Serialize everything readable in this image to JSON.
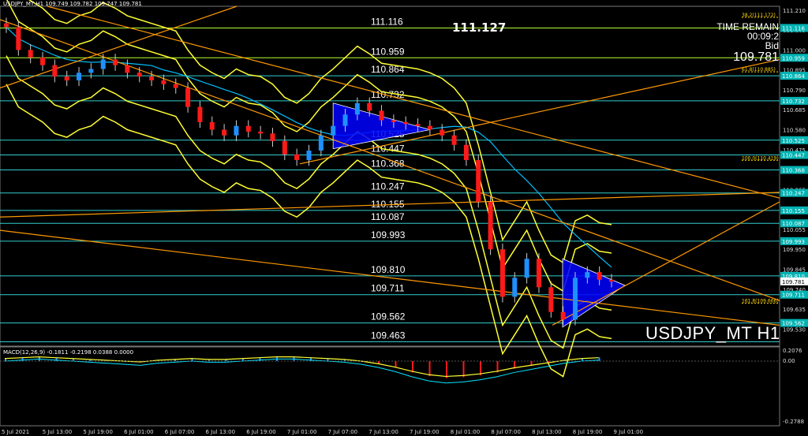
{
  "header": {
    "symbol_line": "USDJPY_MT,H1  109.749 109.782 109.747 109.781",
    "watermark": "USDJPY_MT H1",
    "macd_line": "MACD(12,26,9) -0.1811 -0.2198 0.0388 0.0000"
  },
  "timer": {
    "label": "TIME REMAIN",
    "remain": "00:09:2",
    "bid_label": "Bid",
    "bid": "109.781"
  },
  "current_price_label": "111.127",
  "levels": [
    {
      "value": "111.116",
      "price": 111.116,
      "axis": "111.116"
    },
    {
      "value": "110.959",
      "price": 110.959,
      "axis": "110.959"
    },
    {
      "value": "110.864",
      "price": 110.864,
      "axis": "110.864"
    },
    {
      "value": "110.732",
      "price": 110.732,
      "axis": "110.732"
    },
    {
      "value": "110.525",
      "price": 110.525,
      "axis": "110.525"
    },
    {
      "value": "110.447",
      "price": 110.447,
      "axis": "110.447"
    },
    {
      "value": "110.368",
      "price": 110.368,
      "axis": "110.368"
    },
    {
      "value": "110.247",
      "price": 110.247,
      "axis": "110.247"
    },
    {
      "value": "110.155",
      "price": 110.155,
      "axis": "110.155"
    },
    {
      "value": "110.087",
      "price": 110.087,
      "axis": "110.087"
    },
    {
      "value": "109.993",
      "price": 109.993,
      "axis": "109.993"
    },
    {
      "value": "109.810",
      "price": 109.81,
      "axis": "109.810"
    },
    {
      "value": "109.711",
      "price": 109.711,
      "axis": "109.711"
    },
    {
      "value": "109.562",
      "price": 109.562,
      "axis": "109.562"
    },
    {
      "value": "109.463",
      "price": 109.463,
      "axis": ""
    }
  ],
  "price_axis": [
    "111.210",
    "111.105",
    "111.000",
    "110.895",
    "110.790",
    "110.685",
    "110.580",
    "110.475",
    "110.265",
    "110.160",
    "110.055",
    "109.950",
    "109.845",
    "109.740",
    "109.635",
    "109.530"
  ],
  "macd_axis": [
    "0.2076",
    "0.00",
    "-0.2788"
  ],
  "fibo_labels": [
    "38.2(111.172)",
    "61.8(110.885)",
    "100.0(110.419)",
    "161.8(109.666)"
  ],
  "time_axis": [
    "5 Jul 2021",
    "5 Jul 13:00",
    "5 Jul 19:00",
    "6 Jul 01:00",
    "6 Jul 07:00",
    "6 Jul 13:00",
    "6 Jul 19:00",
    "7 Jul 01:00",
    "7 Jul 07:00",
    "7 Jul 13:00",
    "7 Jul 19:00",
    "8 Jul 01:00",
    "8 Jul 07:00",
    "8 Jul 13:00",
    "8 Jul 19:00",
    "9 Jul 01:00"
  ],
  "colors": {
    "background": "#000000",
    "up_candle": "#1e90ff",
    "down_candle": "#ff1a1a",
    "bands": "#ffff33",
    "trendlines": "#ff9900",
    "level_lines": "#33cccc",
    "ma_cyan": "#00bfff",
    "triangle": "#0000ff",
    "axis_highlight": "#00b3b3",
    "fibo": "#ffd700"
  },
  "chart_data": {
    "type": "candlestick",
    "symbol": "USDJPY_MT",
    "timeframe": "H1",
    "ylim": [
      109.44,
      111.23
    ],
    "close_last": 109.781,
    "series_close_approx": [
      111.12,
      111.0,
      110.96,
      110.92,
      110.86,
      110.84,
      110.88,
      110.9,
      110.95,
      110.92,
      110.88,
      110.86,
      110.84,
      110.82,
      110.8,
      110.7,
      110.62,
      110.58,
      110.55,
      110.6,
      110.57,
      110.56,
      110.52,
      110.45,
      110.42,
      110.47,
      110.55,
      110.6,
      110.66,
      110.72,
      110.68,
      110.63,
      110.62,
      110.61,
      110.6,
      110.58,
      110.55,
      110.5,
      110.42,
      110.2,
      109.95,
      109.7,
      109.8,
      109.9,
      109.75,
      109.62,
      109.58,
      109.8,
      109.83,
      109.79,
      109.78
    ],
    "macd_histogram_approx": [
      0.03,
      0.04,
      0.05,
      0.04,
      0.03,
      0.02,
      0.01,
      0.0,
      -0.01,
      0.01,
      0.02,
      0.03,
      0.02,
      0.02,
      0.03,
      0.04,
      0.05,
      0.05,
      0.04,
      0.03,
      0.02,
      0.0,
      -0.03,
      -0.07,
      -0.12,
      -0.16,
      -0.18,
      -0.17,
      -0.15,
      -0.12,
      -0.08,
      -0.05,
      -0.02,
      0.01,
      0.03,
      0.04
    ]
  }
}
